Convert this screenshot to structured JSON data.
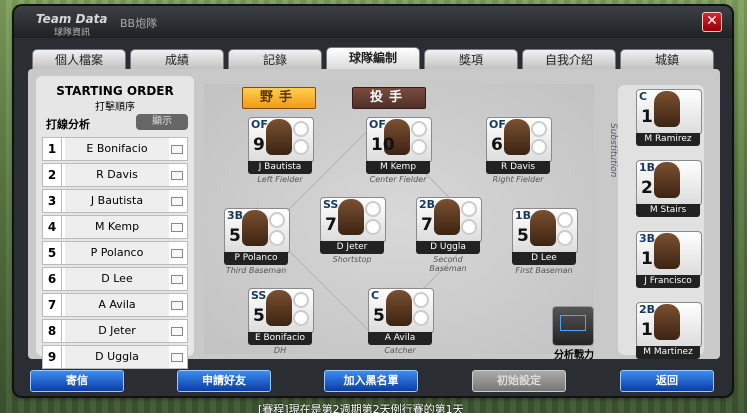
{
  "window": {
    "title": "Team Data",
    "subtitle": "球隊資訊",
    "team_name": "BB炮隊",
    "close_glyph": "✕"
  },
  "tabs": [
    "個人檔案",
    "成績",
    "記錄",
    "球隊編制",
    "獎項",
    "自我介紹",
    "城鎮"
  ],
  "active_tab": 3,
  "left_panel": {
    "title": "STARTING ORDER",
    "subtitle": "打擊順序",
    "analysis_label": "打線分析",
    "analysis_button": "顯示"
  },
  "batting_order": [
    {
      "num": "1",
      "name": "E Bonifacio"
    },
    {
      "num": "2",
      "name": "R Davis"
    },
    {
      "num": "3",
      "name": "J Bautista"
    },
    {
      "num": "4",
      "name": "M Kemp"
    },
    {
      "num": "5",
      "name": "P Polanco"
    },
    {
      "num": "6",
      "name": "D Lee"
    },
    {
      "num": "7",
      "name": "A Avila"
    },
    {
      "num": "8",
      "name": "D Jeter"
    },
    {
      "num": "9",
      "name": "D Uggla"
    }
  ],
  "field_tabs": {
    "fielder": "野手",
    "pitcher": "投手"
  },
  "fielders": {
    "lf": {
      "pos": "OF",
      "num": "9",
      "name": "J Bautista",
      "label": "Left Fielder"
    },
    "cf": {
      "pos": "OF",
      "num": "10",
      "name": "M Kemp",
      "label": "Center Fielder"
    },
    "rf": {
      "pos": "OF",
      "num": "6",
      "name": "R Davis",
      "label": "Right Fielder"
    },
    "b3": {
      "pos": "3B",
      "num": "5",
      "name": "P Polanco",
      "label": "Third Baseman"
    },
    "ss": {
      "pos": "SS",
      "num": "7",
      "name": "D Jeter",
      "label": "Shortstop"
    },
    "b2": {
      "pos": "2B",
      "num": "7",
      "name": "D Uggla",
      "label": "Second Baseman"
    },
    "b1": {
      "pos": "1B",
      "num": "5",
      "name": "D Lee",
      "label": "First Baseman"
    },
    "dh": {
      "pos": "SS",
      "num": "5",
      "name": "E Bonifacio",
      "label": "DH"
    },
    "c": {
      "pos": "C",
      "num": "5",
      "name": "A Avila",
      "label": "Catcher"
    }
  },
  "analyze_label": "分析戰力",
  "substitution": {
    "title": "Substitution",
    "players": [
      {
        "pos": "C",
        "num": "1",
        "name": "M Ramirez"
      },
      {
        "pos": "1B",
        "num": "2",
        "name": "M Stairs"
      },
      {
        "pos": "3B",
        "num": "1",
        "name": "J Francisco"
      },
      {
        "pos": "2B",
        "num": "1",
        "name": "M Martinez"
      }
    ]
  },
  "buttons": {
    "mail": "寄信",
    "friend": "申請好友",
    "blacklist": "加入黑名單",
    "init": "初始設定",
    "back": "返回"
  },
  "ticker": "[賽程]現在是第2週期第2天例行賽的第1天"
}
